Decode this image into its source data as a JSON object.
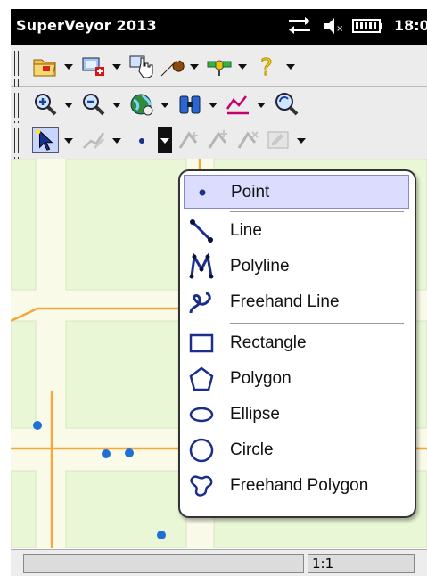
{
  "titlebar": {
    "title": "SuperVeyor 2013",
    "clock": "18:0"
  },
  "toolbars": {
    "row1": [
      "open-folder-icon",
      "add-layer-icon",
      "pointer-hand-icon",
      "wrench-icon",
      "gps-satellite-icon",
      "help-icon"
    ],
    "row2": [
      "zoom-in-icon",
      "zoom-out-icon",
      "globe-icon",
      "binoculars-icon",
      "profile-icon",
      "zoom-refresh-icon"
    ],
    "row3": [
      "select-arrow-icon",
      "edit-line-icon",
      "point-tool-icon",
      "add-vertex-icon",
      "move-vertex-icon",
      "delete-vertex-icon",
      "properties-icon"
    ]
  },
  "menu": {
    "items": [
      {
        "label": "Point",
        "icon": "point-icon"
      },
      {
        "label": "Line",
        "icon": "line-icon"
      },
      {
        "label": "Polyline",
        "icon": "polyline-icon"
      },
      {
        "label": "Freehand Line",
        "icon": "freehand-line-icon"
      },
      {
        "label": "Rectangle",
        "icon": "rectangle-icon"
      },
      {
        "label": "Polygon",
        "icon": "polygon-icon"
      },
      {
        "label": "Ellipse",
        "icon": "ellipse-icon"
      },
      {
        "label": "Circle",
        "icon": "circle-icon"
      },
      {
        "label": "Freehand Polygon",
        "icon": "freehand-polygon-icon"
      }
    ],
    "selected": "Point"
  },
  "statusbar": {
    "scale": "1:1"
  },
  "colors": {
    "map_block": "#eaf7d7",
    "map_road": "#fafae8",
    "map_road_edge": "#d7e6c5",
    "orange_road": "#f4a73b",
    "point_marker": "#1f6fd6",
    "menu_selected": "#dcdcff",
    "icon_blue": "#1a2e8c"
  }
}
